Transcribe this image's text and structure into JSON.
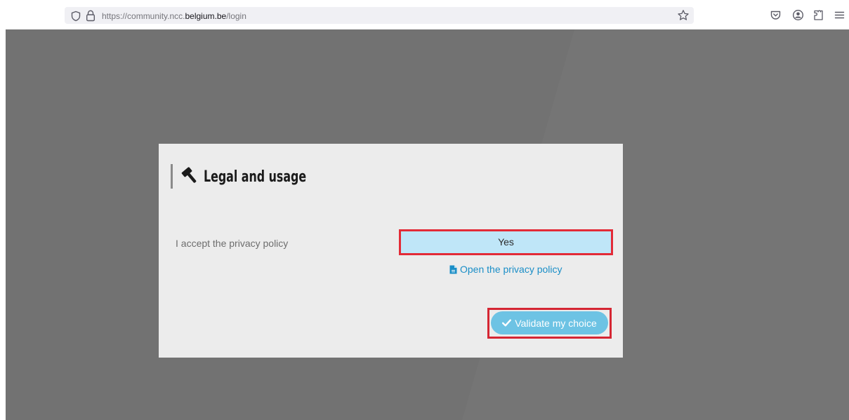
{
  "browser": {
    "url_prefix": "https://community.ncc.",
    "url_domain": "belgium.be",
    "url_path": "/login",
    "icons": [
      "shield-icon",
      "lock-icon",
      "star-icon",
      "pocket-icon",
      "account-icon",
      "extensions-icon",
      "menu-icon"
    ]
  },
  "modal": {
    "title": "Legal and usage",
    "title_icon": "gavel-icon",
    "privacy_label": "I accept the privacy policy",
    "yes_label": "Yes",
    "privacy_link": "Open the privacy policy",
    "validate_label": "Validate my choice"
  },
  "colors": {
    "backdrop": "#757575",
    "modal": "#ececec",
    "yes_button": "#bfe6f8",
    "validate_button": "#6dc3e4",
    "link": "#1a8ec7",
    "highlight": "#e32b37"
  }
}
